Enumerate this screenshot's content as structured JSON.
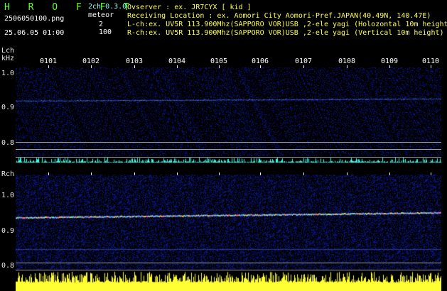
{
  "header": {
    "title": "H R O F F T",
    "mode": "2ch 0.3.0",
    "filename": "2506050100.png",
    "datetime": "25.06.05 01:00",
    "meteor_label": "meteor",
    "meteor_lch": "2",
    "meteor_rch": "100",
    "observer": "Ovserver         : ex. JR7CYX [ kid ]",
    "location": "Receiving Location : ex. Aomori City Aomori-Pref.JAPAN(40.49N, 140.47E)",
    "lch_info": "L-ch:ex. UV5R 113.900Mhz(SAPPORO VOR)USB ,2-ele yagi (Holozontal 10m height",
    "rch_info": "R-ch:ex. UV5R 113.900Mhz(SAPPORO VOR)USB ,2-ele yagi (Vertical 10m height)"
  },
  "lch": {
    "label": "Lch",
    "unit": "kHz",
    "y_labels": [
      "1.0",
      "0.9",
      "0.8"
    ]
  },
  "rch": {
    "label": "Rch",
    "y_labels": [
      "1.0",
      "0.9",
      "0.8"
    ]
  },
  "time_labels": [
    "0101",
    "0102",
    "0103",
    "0104",
    "0105",
    "0106",
    "0107",
    "0108",
    "0109",
    "0110"
  ],
  "colors": {
    "background": "#000000",
    "title_green": "#66ff33",
    "text_cyan": "#7fffff",
    "text_yellow": "#ffff55",
    "lch_noise": "#18184a",
    "rch_noise": "#1a1a5a",
    "signal_trace": "#4da6ff",
    "lch_bar": "#33ffee",
    "rch_bar": "#ffff33"
  }
}
